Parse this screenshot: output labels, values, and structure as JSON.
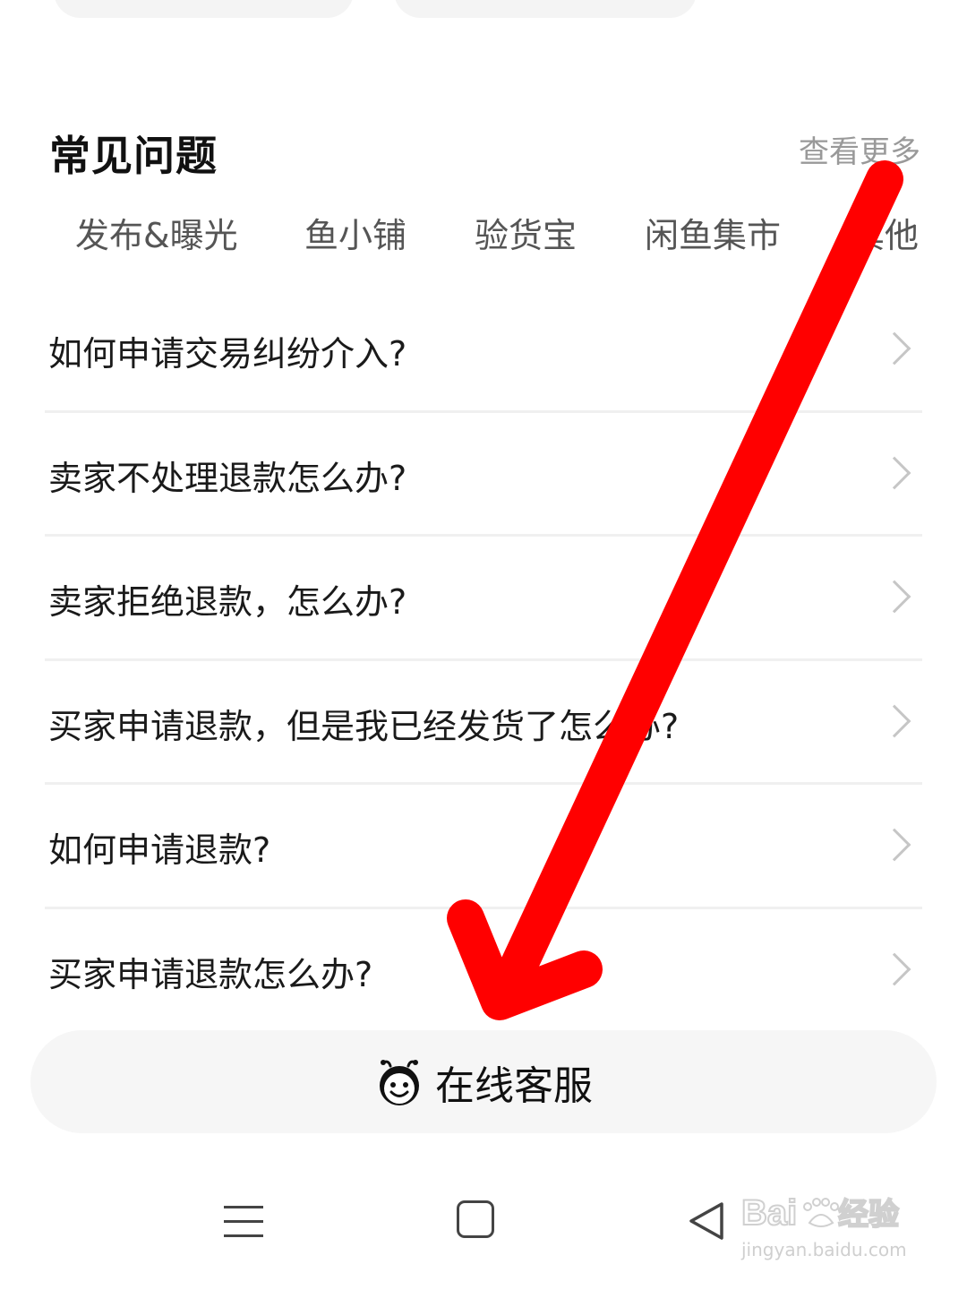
{
  "faq": {
    "title": "常见问题",
    "see_more": "查看更多",
    "tabs": [
      {
        "label": "发布&曝光"
      },
      {
        "label": "鱼小铺"
      },
      {
        "label": "验货宝"
      },
      {
        "label": "闲鱼集市"
      },
      {
        "label": "其他"
      }
    ],
    "questions": [
      {
        "text": "如何申请交易纠纷介入?"
      },
      {
        "text": "卖家不处理退款怎么办?"
      },
      {
        "text": "卖家拒绝退款，怎么办?"
      },
      {
        "text": "买家申请退款，但是我已经发货了怎么办?"
      },
      {
        "text": "如何申请退款?"
      },
      {
        "text": "买家申请退款怎么办?"
      }
    ]
  },
  "service_button": {
    "label": "在线客服",
    "icon": "bee-mascot-icon"
  },
  "nav_bar": {
    "icons": [
      "menu-icon",
      "home-icon",
      "back-icon"
    ]
  },
  "watermark": {
    "brand": "Baidu 经验",
    "url": "jingyan.baidu.com"
  },
  "annotation": {
    "color": "#ff0000",
    "icon": "red-arrow-annotation"
  }
}
